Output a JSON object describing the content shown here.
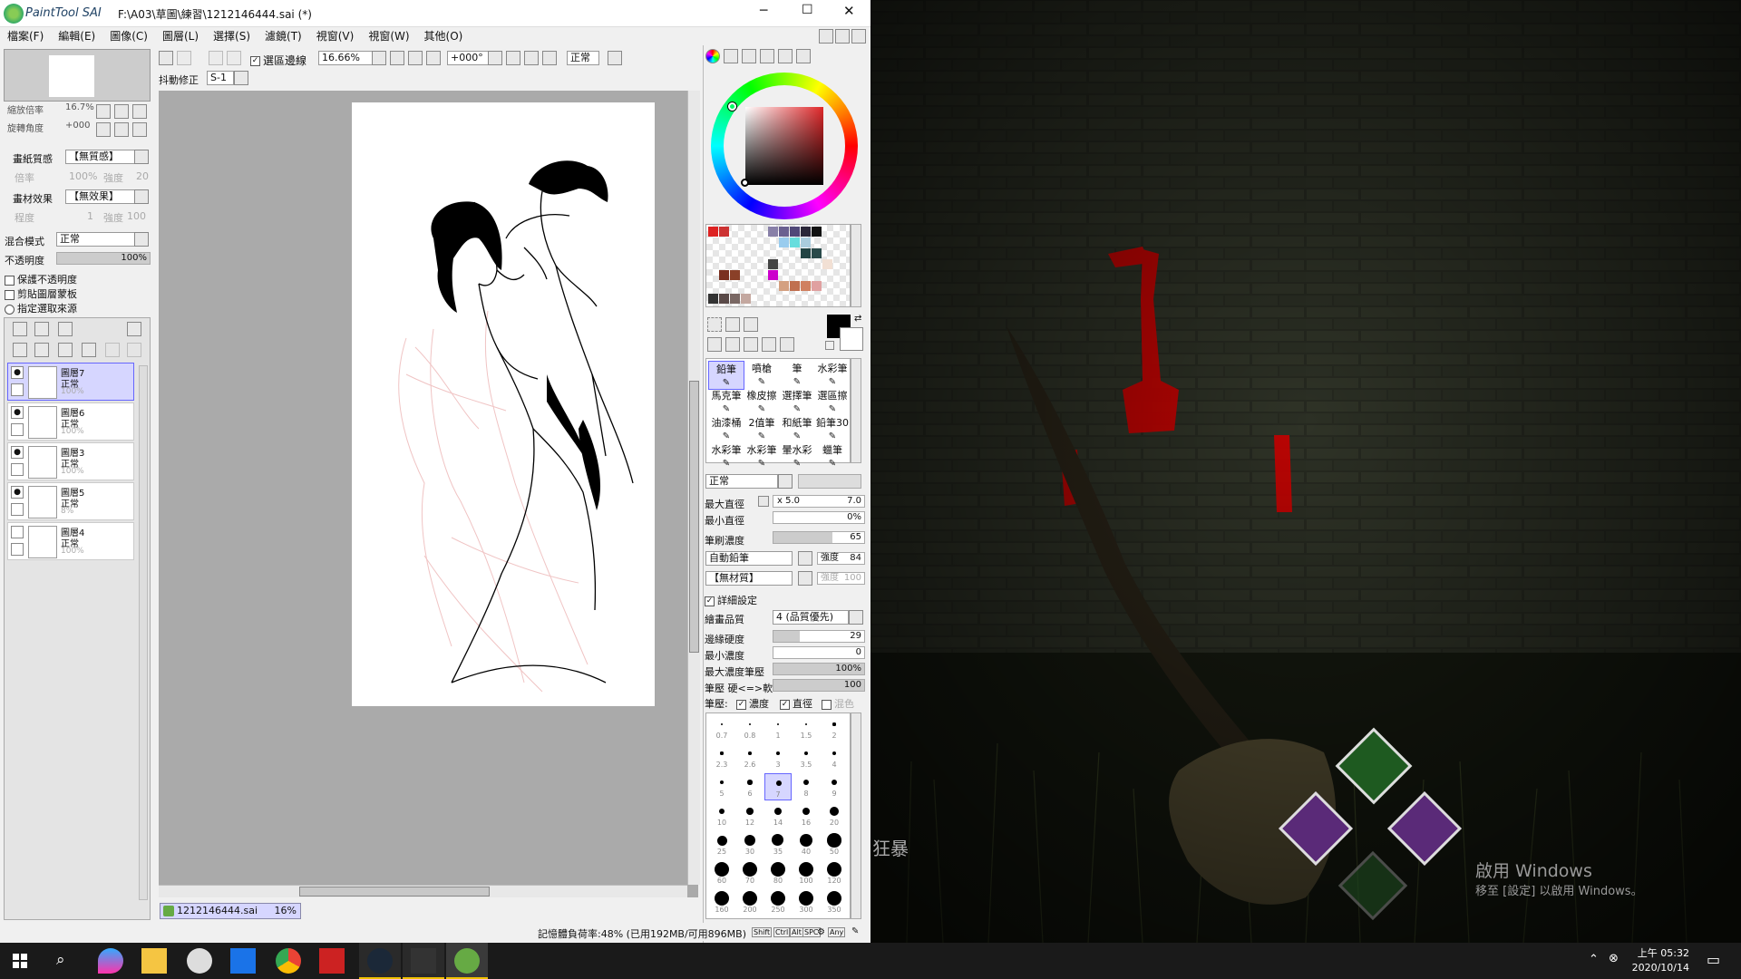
{
  "window": {
    "app_logo": "PaintTool SAI",
    "title": "F:\\A03\\草圖\\練習\\1212146444.sai (*)"
  },
  "menu": [
    "檔案(F)",
    "編輯(E)",
    "圖像(C)",
    "圖層(L)",
    "選擇(S)",
    "濾鏡(T)",
    "視窗(V)",
    "視窗(W)",
    "其他(O)"
  ],
  "toolbar": {
    "antialias_label": "選區邊線",
    "zoom": "16.66%",
    "rotation": "+000°",
    "blend": "正常",
    "stabilizer_label": "抖動修正",
    "stabilizer_value": "S-1"
  },
  "navigator": {
    "zoom_label": "縮放倍率",
    "zoom_value": "16.7%",
    "angle_label": "旋轉角度",
    "angle_value": "+000"
  },
  "paper": {
    "texture_label": "畫紙質感",
    "texture_value": "【無質感】",
    "rate_label": "倍率",
    "rate_value": "100%",
    "strength_label": "強度",
    "strength_value": "20",
    "effect_label": "畫材效果",
    "effect_value": "【無效果】",
    "degree_label": "程度",
    "degree_value": "1",
    "strength2_value": "100"
  },
  "layer_props": {
    "mode_label": "混合模式",
    "mode_value": "正常",
    "opacity_label": "不透明度",
    "opacity_value": "100%",
    "opacity": 1.0,
    "preserve": "保護不透明度",
    "clip": "剪貼圖層蒙板",
    "source": "指定選取來源"
  },
  "layers": [
    {
      "name": "圖層7",
      "mode": "正常",
      "opacity": "100%",
      "visible": true,
      "selected": true
    },
    {
      "name": "圖層6",
      "mode": "正常",
      "opacity": "100%",
      "visible": true,
      "selected": false
    },
    {
      "name": "圖層3",
      "mode": "正常",
      "opacity": "100%",
      "visible": true,
      "selected": false
    },
    {
      "name": "圖層5",
      "mode": "正常",
      "opacity": "8%",
      "visible": true,
      "selected": false
    },
    {
      "name": "圖層4",
      "mode": "正常",
      "opacity": "100%",
      "visible": false,
      "selected": false
    }
  ],
  "brushes": [
    "鉛筆",
    "噴槍",
    "筆",
    "水彩筆",
    "馬克筆",
    "橡皮擦",
    "選擇筆",
    "選區擦",
    "油漆桶",
    "2值筆",
    "和紙筆",
    "鉛筆30",
    "水彩筆",
    "水彩筆",
    "暈水彩",
    "蠟筆"
  ],
  "brush_settings": {
    "mode": "正常",
    "max_size_label": "最大直徑",
    "max_size_mult": "x 5.0",
    "max_size": "7.0",
    "min_size_label": "最小直徑",
    "min_size": "0%",
    "min_size_fill": 0,
    "density_label": "筆刷濃度",
    "density": "65",
    "density_fill": 0.65,
    "shape": "自動鉛筆",
    "shape_strength_label": "強度",
    "shape_strength": "84",
    "texture": "【無材質】",
    "texture_strength_label": "強度",
    "texture_strength": "100",
    "advanced_label": "詳細設定",
    "quality_label": "繪畫品質",
    "quality": "4 (品質優先)",
    "edge_label": "邊緣硬度",
    "edge": "29",
    "edge_fill": 0.29,
    "min_density_label": "最小濃度",
    "min_density": "0",
    "min_density_fill": 0,
    "max_pressure_label": "最大濃度筆壓",
    "max_pressure": "100%",
    "max_pressure_fill": 1.0,
    "hardsoft_label": "筆壓 硬<=>軟",
    "hardsoft": "100",
    "hardsoft_fill": 1.0,
    "pressure_label": "筆壓:",
    "p_density": "濃度",
    "p_size": "直徑",
    "p_blend": "混色"
  },
  "brush_sizes": [
    "0.7",
    "0.8",
    "1",
    "1.5",
    "2",
    "2.3",
    "2.6",
    "3",
    "3.5",
    "4",
    "5",
    "6",
    "7",
    "8",
    "9",
    "10",
    "12",
    "14",
    "16",
    "20",
    "25",
    "30",
    "35",
    "40",
    "50",
    "60",
    "70",
    "80",
    "100",
    "120",
    "160",
    "200",
    "250",
    "300",
    "350"
  ],
  "colors": {
    "primary": "#000000",
    "secondary": "#ffffff",
    "selected_layer": "#d6d6ff",
    "accent": "#6666ff"
  },
  "document_tab": {
    "name": "1212146444.sai",
    "zoom": "16%"
  },
  "status": {
    "memory": "記憶體負荷率:48% (已用192MB/可用896MB)",
    "keys": [
      "Shift",
      "Ctrl",
      "Alt",
      "SPC",
      "Any"
    ]
  },
  "game": {
    "overlay_text": "狂暴",
    "watermark_title": "啟用 Windows",
    "watermark_sub": "移至 [設定] 以啟用 Windows。"
  },
  "taskbar": {
    "time": "上午 05:32",
    "date": "2020/10/14"
  }
}
